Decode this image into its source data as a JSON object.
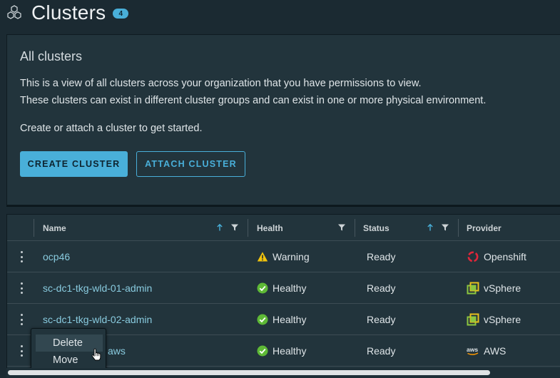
{
  "header": {
    "title": "Clusters",
    "count": "4",
    "icon": "clusters-hexagon-icon"
  },
  "card": {
    "title": "All clusters",
    "line1": "This is a view of all clusters across your organization that you have permissions to view.",
    "line2": "These clusters can exist in different cluster groups and can exist in one or more physical environment.",
    "line3": "Create or attach a cluster to get started.",
    "create_label": "CREATE CLUSTER",
    "attach_label": "ATTACH CLUSTER"
  },
  "grid": {
    "columns": {
      "name": "Name",
      "health": "Health",
      "status": "Status",
      "provider": "Provider"
    },
    "rows": [
      {
        "name": "ocp46",
        "health": "Warning",
        "health_icon": "warning-icon",
        "status": "Ready",
        "provider": "Openshift",
        "provider_icon": "openshift-icon"
      },
      {
        "name": "sc-dc1-tkg-wld-01-admin",
        "health": "Healthy",
        "health_icon": "check-circle-icon",
        "status": "Ready",
        "provider": "vSphere",
        "provider_icon": "vsphere-icon"
      },
      {
        "name": "sc-dc1-tkg-wld-02-admin",
        "health": "Healthy",
        "health_icon": "check-circle-icon",
        "status": "Ready",
        "provider": "vSphere",
        "provider_icon": "vsphere-icon"
      },
      {
        "name": "aws",
        "health": "Healthy",
        "health_icon": "check-circle-icon",
        "status": "Ready",
        "provider": "AWS",
        "provider_icon": "aws-icon"
      }
    ]
  },
  "context_menu": {
    "items": [
      "Delete",
      "Move"
    ]
  },
  "colors": {
    "accent": "#49afd9",
    "background": "#1b2a32",
    "panel": "#22343c",
    "link": "#89cbdf",
    "warning": "#f2c40d",
    "healthy": "#5eb936"
  }
}
